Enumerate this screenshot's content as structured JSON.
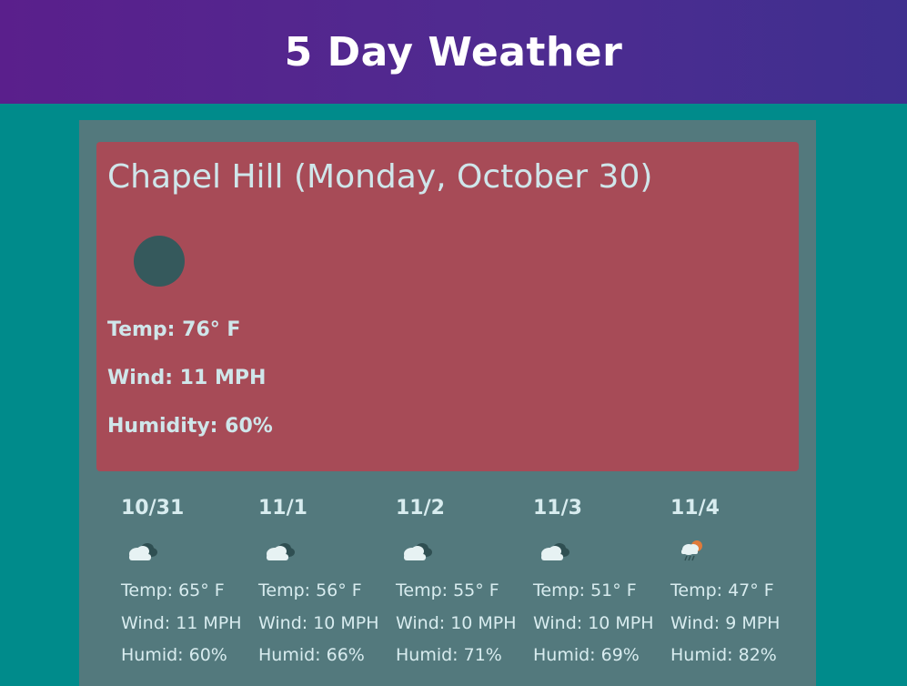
{
  "header": {
    "title": "5 Day Weather"
  },
  "today": {
    "heading": "Chapel Hill (Monday, October 30)",
    "icon": "weather-icon",
    "temp": "Temp: 76° F",
    "wind": "Wind: 11 MPH",
    "humidity": "Humidity: 60%"
  },
  "forecast": [
    {
      "date": "10/31",
      "icon": "cloudy-icon",
      "temp": "Temp: 65° F",
      "wind": "Wind: 11 MPH",
      "humid": "Humid: 60%"
    },
    {
      "date": "11/1",
      "icon": "cloudy-icon",
      "temp": "Temp: 56° F",
      "wind": "Wind: 10 MPH",
      "humid": "Humid: 66%"
    },
    {
      "date": "11/2",
      "icon": "cloudy-icon",
      "temp": "Temp: 55° F",
      "wind": "Wind: 10 MPH",
      "humid": "Humid: 71%"
    },
    {
      "date": "11/3",
      "icon": "cloudy-icon",
      "temp": "Temp: 51° F",
      "wind": "Wind: 10 MPH",
      "humid": "Humid: 69%"
    },
    {
      "date": "11/4",
      "icon": "rain-sun-icon",
      "temp": "Temp: 47° F",
      "wind": "Wind: 9 MPH",
      "humid": "Humid: 82%"
    }
  ],
  "colors": {
    "page_bg": "#008b8b",
    "header_bg": "#4f2b90",
    "container_bg": "#53797d",
    "today_bg": "#a74b57",
    "text": "#cfe6ea"
  }
}
